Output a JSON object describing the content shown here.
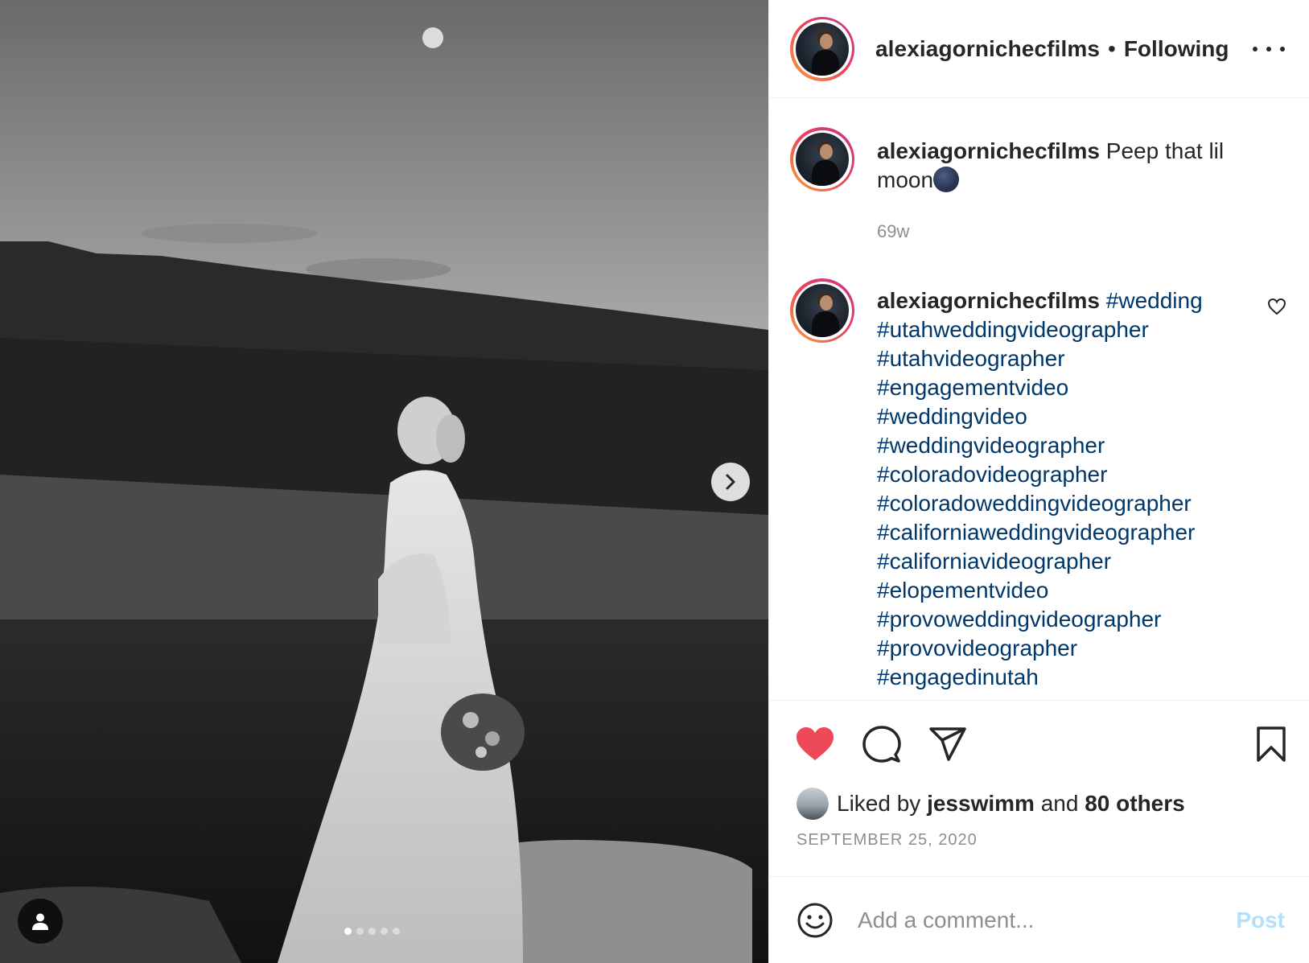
{
  "post": {
    "username": "alexiagornichecfilms",
    "separator": "•",
    "follow_status": "Following"
  },
  "comments": [
    {
      "username": "alexiagornichecfilms",
      "text": "Peep that lil moon",
      "emoji": "new-moon-emoji",
      "time": "69w"
    },
    {
      "username": "alexiagornichecfilms",
      "hashtags": [
        "#wedding",
        "#utahweddingvideographer",
        "#utahvideographer",
        "#engagementvideo",
        "#weddingvideo",
        "#weddingvideographer",
        "#coloradovideographer",
        "#coloradoweddingvideographer",
        "#californiaweddingvideographer",
        "#californiavideographer",
        "#elopementvideo",
        "#provoweddingvideographer",
        "#provovideographer",
        "#engagedinutah"
      ]
    }
  ],
  "actions": {
    "icons": [
      "heart-filled-icon",
      "comment-icon",
      "share-icon",
      "bookmark-icon"
    ],
    "liked": true,
    "like_color": "#ed4956"
  },
  "likes": {
    "prefix": "Liked by",
    "user": "jesswimm",
    "conjunction": "and",
    "others": "80 others"
  },
  "date": "SEPTEMBER 25, 2020",
  "add_comment": {
    "placeholder": "Add a comment...",
    "post_label": "Post",
    "post_color": "#b2dffc"
  },
  "carousel": {
    "slide_count": 5,
    "active_index": 0
  }
}
